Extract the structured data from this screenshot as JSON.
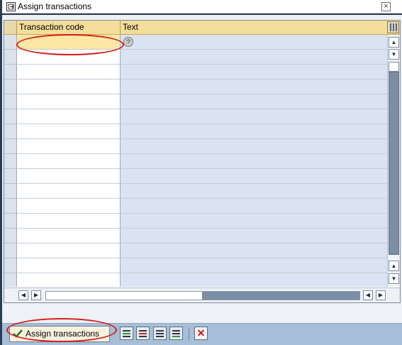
{
  "window": {
    "title": "Assign transactions",
    "close_glyph": "×",
    "title_icon": "dialog-window-icon"
  },
  "table": {
    "columns": [
      "Transaction code",
      "Text"
    ],
    "rows": [
      {
        "code": "",
        "text": ""
      },
      {
        "code": "",
        "text": ""
      },
      {
        "code": "",
        "text": ""
      },
      {
        "code": "",
        "text": ""
      },
      {
        "code": "",
        "text": ""
      },
      {
        "code": "",
        "text": ""
      },
      {
        "code": "",
        "text": ""
      },
      {
        "code": "",
        "text": ""
      },
      {
        "code": "",
        "text": ""
      },
      {
        "code": "",
        "text": ""
      },
      {
        "code": "",
        "text": ""
      },
      {
        "code": "",
        "text": ""
      },
      {
        "code": "",
        "text": ""
      },
      {
        "code": "",
        "text": ""
      },
      {
        "code": "",
        "text": ""
      },
      {
        "code": "",
        "text": ""
      },
      {
        "code": "",
        "text": ""
      }
    ],
    "config_icon": "table-settings-icon",
    "value_help_icon": "f4-value-help-icon",
    "scroll_glyphs": {
      "up": "▲",
      "down": "▼",
      "left": "◀",
      "right": "▶"
    }
  },
  "toolbar": {
    "assign_label": "Assign transactions",
    "assign_icon": "checkmark-icon",
    "buttons": [
      "insert-row-icon",
      "delete-row-icon",
      "select-all-icon",
      "deselect-all-icon"
    ],
    "cancel_glyph": "✕",
    "cancel_icon": "cancel-icon"
  },
  "colors": {
    "header_bg": "#f3dd9a",
    "text_column_bg": "#d9e3f1",
    "toolbar_bg": "#a7bed8",
    "highlight": "#d61b1b",
    "cancel": "#d41010"
  }
}
